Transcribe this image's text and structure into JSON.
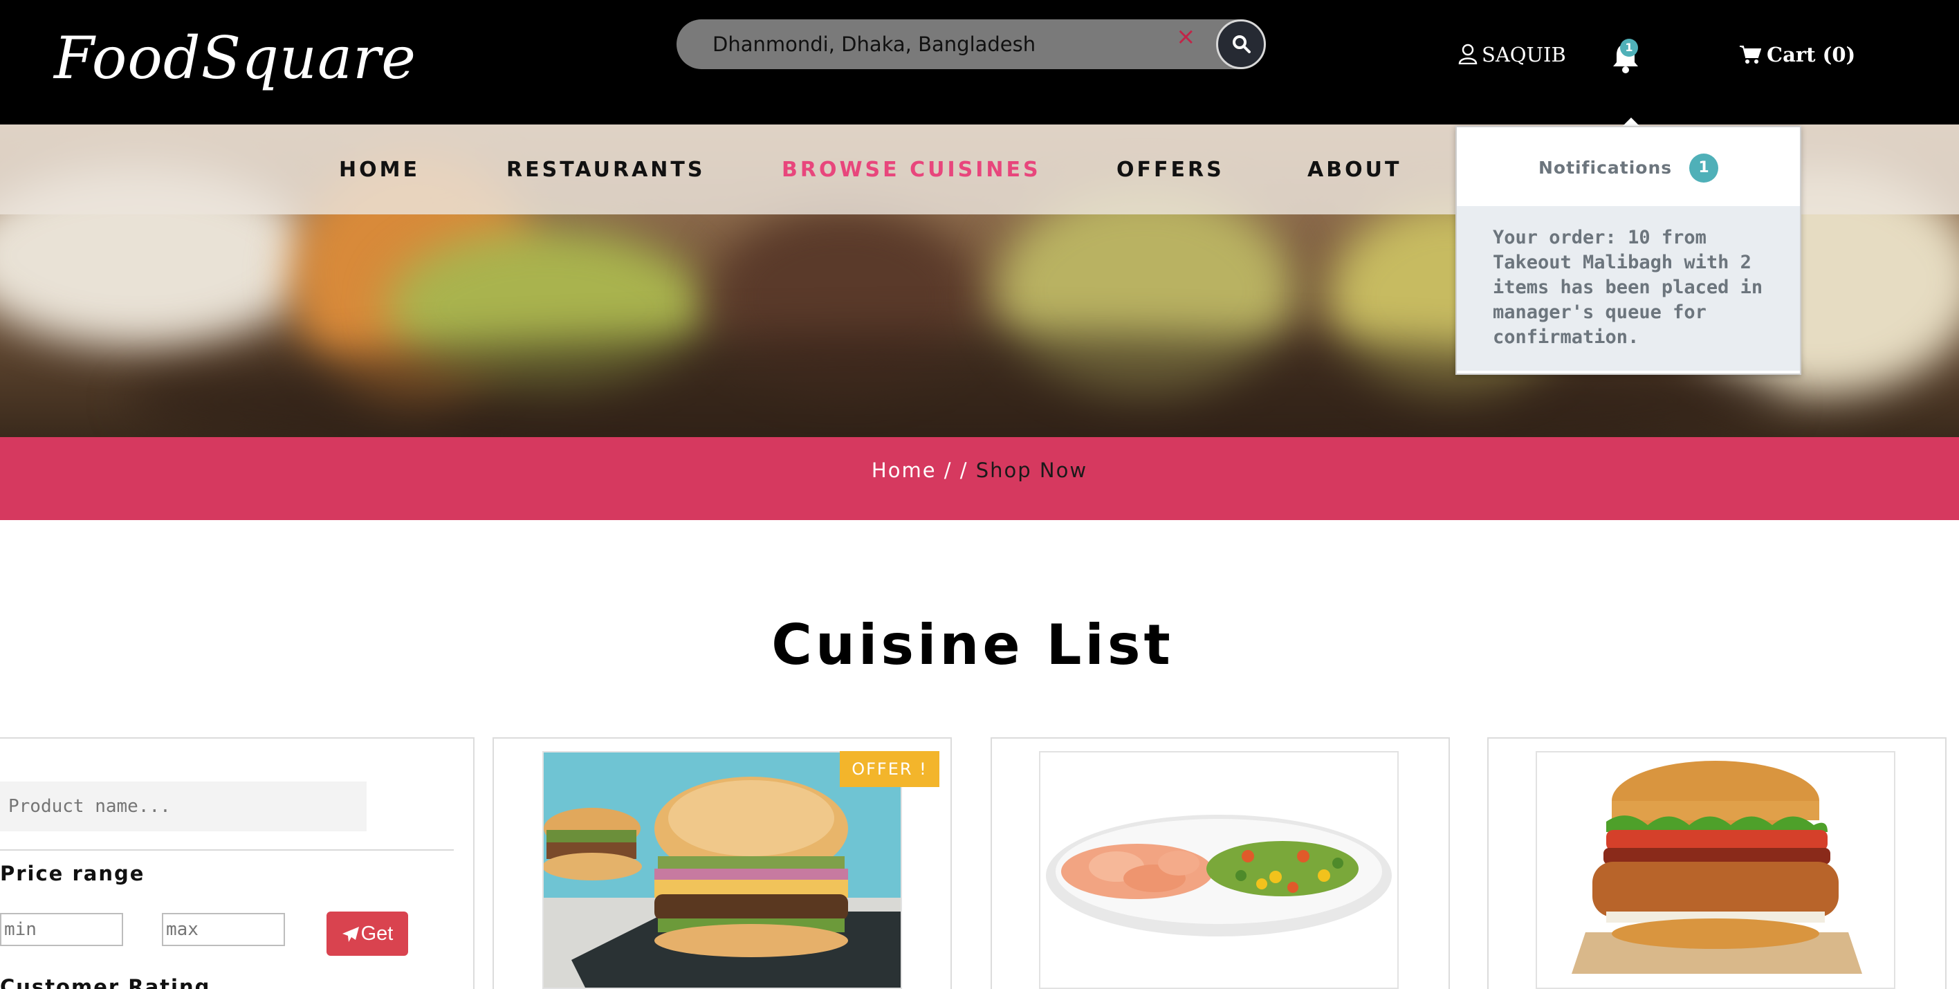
{
  "header": {
    "logo": "FoodSquare",
    "search": {
      "value": "Dhanmondi, Dhaka, Bangladesh",
      "clear_icon": "×"
    },
    "user": "SAQUIB",
    "notification_badge": "1",
    "cart": "Cart (0)"
  },
  "nav": {
    "items": [
      {
        "label": "HOME"
      },
      {
        "label": "RESTAURANTS"
      },
      {
        "label": "BROWSE CUISINES"
      },
      {
        "label": "OFFERS"
      },
      {
        "label": "ABOUT"
      }
    ],
    "active_index": 2
  },
  "notifications": {
    "title": "Notifications",
    "count": "1",
    "items": [
      {
        "message": "Your order: 10 from Takeout Malibagh with 2 items has been placed in manager's queue for confirmation."
      }
    ]
  },
  "breadcrumb": {
    "home": "Home",
    "separator": " / / ",
    "current": "Shop Now"
  },
  "page_title": "Cuisine List",
  "filter": {
    "product_placeholder": "Product name...",
    "price_label": "Price range",
    "min_placeholder": "min",
    "max_placeholder": "max",
    "get_label": "Get",
    "rating_label": "Customer Rating"
  },
  "products": [
    {
      "image": "burger-with-slaw",
      "badge": "OFFER !"
    },
    {
      "image": "shrimp-and-vegetables-plate",
      "badge": ""
    },
    {
      "image": "bacon-chicken-burger",
      "badge": ""
    }
  ],
  "colors": {
    "topbar": "#000000",
    "accent_pink": "#e8467c",
    "breadcrumb_bar": "#d6395f",
    "badge_teal": "#4fb0b8",
    "offer_yellow": "#f3b52b",
    "get_button": "#d9434f"
  }
}
